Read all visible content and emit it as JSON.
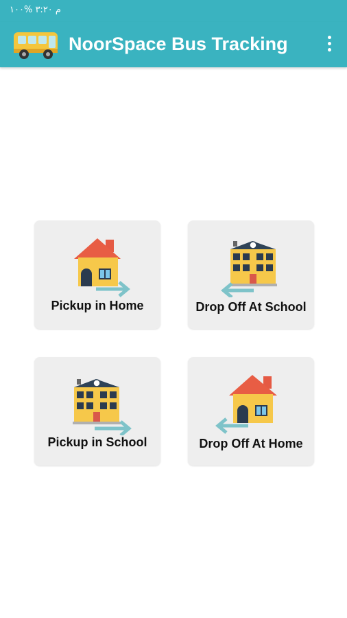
{
  "status_bar": {
    "text": "م ٣:٢٠  %١٠٠"
  },
  "app_bar": {
    "title": "NoorSpace Bus Tracking",
    "menu_icon": "more-vert-icon"
  },
  "colors": {
    "primary": "#3ab3c0",
    "card_bg": "#eeeeee",
    "arrow": "#7ec3c9"
  },
  "cards": [
    {
      "label": "Pickup in Home",
      "icon": "home-arrow-right-icon"
    },
    {
      "label": "Drop Off At School",
      "icon": "school-arrow-left-icon"
    },
    {
      "label": "Pickup in School",
      "icon": "school-arrow-right-icon"
    },
    {
      "label": "Drop Off At Home",
      "icon": "home-arrow-left-icon"
    }
  ]
}
